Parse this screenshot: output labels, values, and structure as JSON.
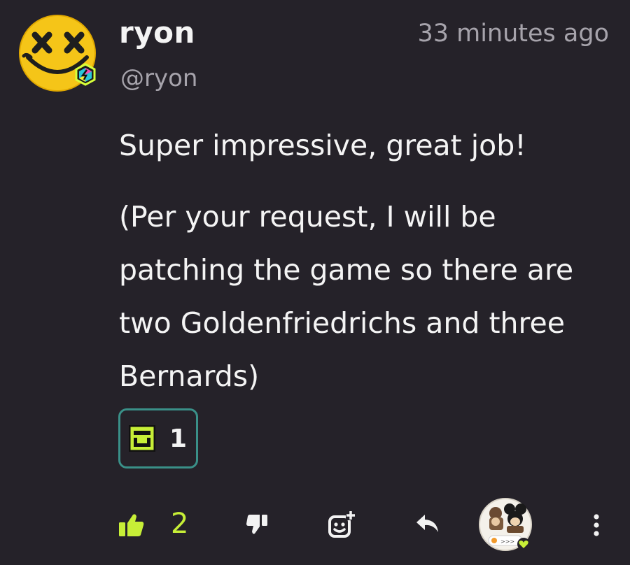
{
  "comment": {
    "author_name": "ryon",
    "author_handle": "@ryon",
    "timestamp": "33 minutes ago",
    "paragraphs": [
      "Super impressive, great job!",
      "(Per your request, I will be patching the game so there are two Goldenfriedrichs and three Bernards)"
    ]
  },
  "reactions": [
    {
      "icon": "green-block-emoji",
      "count": "1"
    }
  ],
  "actions": {
    "like_count": "2",
    "voter_badge_text": ">>>"
  },
  "colors": {
    "background": "#252229",
    "accent_green": "#c7ef37",
    "chip_border": "#3a9088",
    "muted_text": "#a6a3ab"
  }
}
